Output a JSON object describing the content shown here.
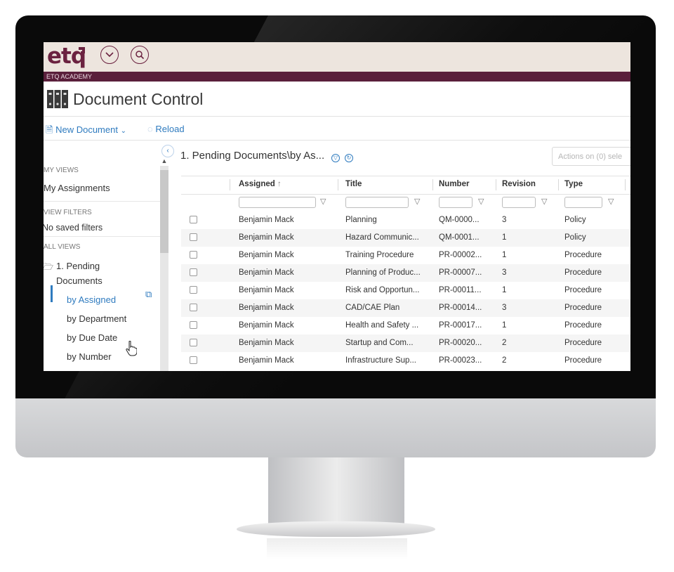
{
  "app": {
    "logo": "etq",
    "academy_label": "ETQ ACADEMY",
    "page_title": "Document Control"
  },
  "toolbar": {
    "new_document": "New Document",
    "reload": "Reload"
  },
  "sidebar": {
    "my_views_header": "MY VIEWS",
    "my_assignments": "My Assignments",
    "view_filters_header": "VIEW FILTERS",
    "no_saved_filters": "No saved filters",
    "all_views_header": "ALL VIEWS",
    "folder_label_1": "1. Pending",
    "folder_label_2": "Documents",
    "sub_items": [
      "by Assigned",
      "by Department",
      "by Due Date",
      "by Number"
    ]
  },
  "main": {
    "view_title": "1. Pending Documents\\by As...",
    "actions_button": "Actions on (0) sele",
    "columns": [
      "Assigned",
      "Title",
      "Number",
      "Revision",
      "Type"
    ],
    "sort_indicator": "↑",
    "rows": [
      [
        "Benjamin Mack",
        "Planning",
        "QM-0000...",
        "3",
        "Policy"
      ],
      [
        "Benjamin Mack",
        "Hazard Communic...",
        "QM-0001...",
        "1",
        "Policy"
      ],
      [
        "Benjamin Mack",
        "Training Procedure",
        "PR-00002...",
        "1",
        "Procedure"
      ],
      [
        "Benjamin Mack",
        "Planning of Produc...",
        "PR-00007...",
        "3",
        "Procedure"
      ],
      [
        "Benjamin Mack",
        "Risk and Opportun...",
        "PR-00011...",
        "1",
        "Procedure"
      ],
      [
        "Benjamin Mack",
        "CAD/CAE Plan",
        "PR-00014...",
        "3",
        "Procedure"
      ],
      [
        "Benjamin Mack",
        "Health and Safety ...",
        "PR-00017...",
        "1",
        "Procedure"
      ],
      [
        "Benjamin Mack",
        "Startup and Com...",
        "PR-00020...",
        "2",
        "Procedure"
      ],
      [
        "Benjamin Mack",
        "Infrastructure Sup...",
        "PR-00023...",
        "2",
        "Procedure"
      ]
    ]
  },
  "colors": {
    "brand": "#6b2240",
    "accent": "#2f7bbf",
    "topbar": "#ede5de"
  }
}
